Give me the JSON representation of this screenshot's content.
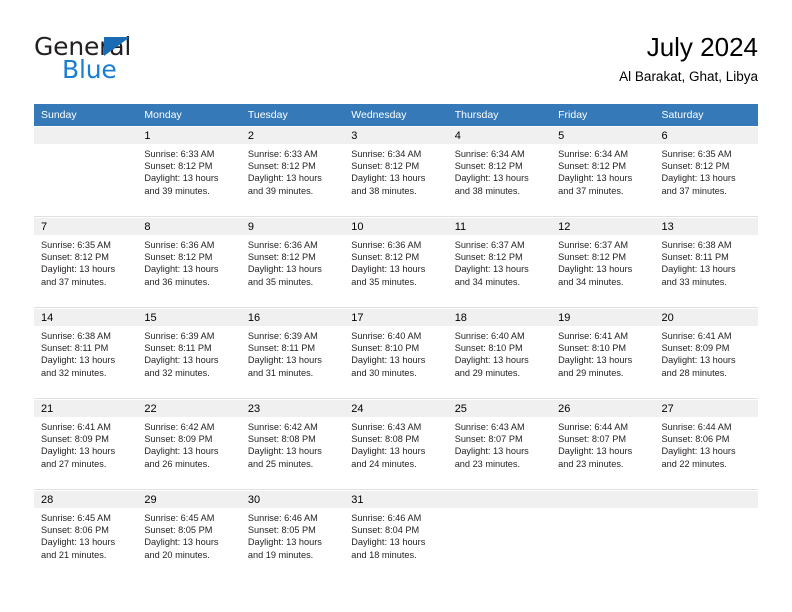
{
  "brand": {
    "name_top": "General",
    "name_bottom": "Blue",
    "triangle_color": "#1a6db5",
    "blue_text_color": "#1a7fd4"
  },
  "header": {
    "title": "July 2024",
    "subtitle": "Al Barakat, Ghat, Libya"
  },
  "theme": {
    "header_bg": "#3579b9",
    "header_text": "#ffffff",
    "daynum_bg": "#f0f0f0",
    "body_text": "#231f20"
  },
  "weekdays": [
    "Sunday",
    "Monday",
    "Tuesday",
    "Wednesday",
    "Thursday",
    "Friday",
    "Saturday"
  ],
  "weeks": [
    [
      {
        "day": "",
        "lines": []
      },
      {
        "day": "1",
        "lines": [
          "Sunrise: 6:33 AM",
          "Sunset: 8:12 PM",
          "Daylight: 13 hours",
          "and 39 minutes."
        ]
      },
      {
        "day": "2",
        "lines": [
          "Sunrise: 6:33 AM",
          "Sunset: 8:12 PM",
          "Daylight: 13 hours",
          "and 39 minutes."
        ]
      },
      {
        "day": "3",
        "lines": [
          "Sunrise: 6:34 AM",
          "Sunset: 8:12 PM",
          "Daylight: 13 hours",
          "and 38 minutes."
        ]
      },
      {
        "day": "4",
        "lines": [
          "Sunrise: 6:34 AM",
          "Sunset: 8:12 PM",
          "Daylight: 13 hours",
          "and 38 minutes."
        ]
      },
      {
        "day": "5",
        "lines": [
          "Sunrise: 6:34 AM",
          "Sunset: 8:12 PM",
          "Daylight: 13 hours",
          "and 37 minutes."
        ]
      },
      {
        "day": "6",
        "lines": [
          "Sunrise: 6:35 AM",
          "Sunset: 8:12 PM",
          "Daylight: 13 hours",
          "and 37 minutes."
        ]
      }
    ],
    [
      {
        "day": "7",
        "lines": [
          "Sunrise: 6:35 AM",
          "Sunset: 8:12 PM",
          "Daylight: 13 hours",
          "and 37 minutes."
        ]
      },
      {
        "day": "8",
        "lines": [
          "Sunrise: 6:36 AM",
          "Sunset: 8:12 PM",
          "Daylight: 13 hours",
          "and 36 minutes."
        ]
      },
      {
        "day": "9",
        "lines": [
          "Sunrise: 6:36 AM",
          "Sunset: 8:12 PM",
          "Daylight: 13 hours",
          "and 35 minutes."
        ]
      },
      {
        "day": "10",
        "lines": [
          "Sunrise: 6:36 AM",
          "Sunset: 8:12 PM",
          "Daylight: 13 hours",
          "and 35 minutes."
        ]
      },
      {
        "day": "11",
        "lines": [
          "Sunrise: 6:37 AM",
          "Sunset: 8:12 PM",
          "Daylight: 13 hours",
          "and 34 minutes."
        ]
      },
      {
        "day": "12",
        "lines": [
          "Sunrise: 6:37 AM",
          "Sunset: 8:12 PM",
          "Daylight: 13 hours",
          "and 34 minutes."
        ]
      },
      {
        "day": "13",
        "lines": [
          "Sunrise: 6:38 AM",
          "Sunset: 8:11 PM",
          "Daylight: 13 hours",
          "and 33 minutes."
        ]
      }
    ],
    [
      {
        "day": "14",
        "lines": [
          "Sunrise: 6:38 AM",
          "Sunset: 8:11 PM",
          "Daylight: 13 hours",
          "and 32 minutes."
        ]
      },
      {
        "day": "15",
        "lines": [
          "Sunrise: 6:39 AM",
          "Sunset: 8:11 PM",
          "Daylight: 13 hours",
          "and 32 minutes."
        ]
      },
      {
        "day": "16",
        "lines": [
          "Sunrise: 6:39 AM",
          "Sunset: 8:11 PM",
          "Daylight: 13 hours",
          "and 31 minutes."
        ]
      },
      {
        "day": "17",
        "lines": [
          "Sunrise: 6:40 AM",
          "Sunset: 8:10 PM",
          "Daylight: 13 hours",
          "and 30 minutes."
        ]
      },
      {
        "day": "18",
        "lines": [
          "Sunrise: 6:40 AM",
          "Sunset: 8:10 PM",
          "Daylight: 13 hours",
          "and 29 minutes."
        ]
      },
      {
        "day": "19",
        "lines": [
          "Sunrise: 6:41 AM",
          "Sunset: 8:10 PM",
          "Daylight: 13 hours",
          "and 29 minutes."
        ]
      },
      {
        "day": "20",
        "lines": [
          "Sunrise: 6:41 AM",
          "Sunset: 8:09 PM",
          "Daylight: 13 hours",
          "and 28 minutes."
        ]
      }
    ],
    [
      {
        "day": "21",
        "lines": [
          "Sunrise: 6:41 AM",
          "Sunset: 8:09 PM",
          "Daylight: 13 hours",
          "and 27 minutes."
        ]
      },
      {
        "day": "22",
        "lines": [
          "Sunrise: 6:42 AM",
          "Sunset: 8:09 PM",
          "Daylight: 13 hours",
          "and 26 minutes."
        ]
      },
      {
        "day": "23",
        "lines": [
          "Sunrise: 6:42 AM",
          "Sunset: 8:08 PM",
          "Daylight: 13 hours",
          "and 25 minutes."
        ]
      },
      {
        "day": "24",
        "lines": [
          "Sunrise: 6:43 AM",
          "Sunset: 8:08 PM",
          "Daylight: 13 hours",
          "and 24 minutes."
        ]
      },
      {
        "day": "25",
        "lines": [
          "Sunrise: 6:43 AM",
          "Sunset: 8:07 PM",
          "Daylight: 13 hours",
          "and 23 minutes."
        ]
      },
      {
        "day": "26",
        "lines": [
          "Sunrise: 6:44 AM",
          "Sunset: 8:07 PM",
          "Daylight: 13 hours",
          "and 23 minutes."
        ]
      },
      {
        "day": "27",
        "lines": [
          "Sunrise: 6:44 AM",
          "Sunset: 8:06 PM",
          "Daylight: 13 hours",
          "and 22 minutes."
        ]
      }
    ],
    [
      {
        "day": "28",
        "lines": [
          "Sunrise: 6:45 AM",
          "Sunset: 8:06 PM",
          "Daylight: 13 hours",
          "and 21 minutes."
        ]
      },
      {
        "day": "29",
        "lines": [
          "Sunrise: 6:45 AM",
          "Sunset: 8:05 PM",
          "Daylight: 13 hours",
          "and 20 minutes."
        ]
      },
      {
        "day": "30",
        "lines": [
          "Sunrise: 6:46 AM",
          "Sunset: 8:05 PM",
          "Daylight: 13 hours",
          "and 19 minutes."
        ]
      },
      {
        "day": "31",
        "lines": [
          "Sunrise: 6:46 AM",
          "Sunset: 8:04 PM",
          "Daylight: 13 hours",
          "and 18 minutes."
        ]
      },
      {
        "day": "",
        "lines": []
      },
      {
        "day": "",
        "lines": []
      },
      {
        "day": "",
        "lines": []
      }
    ]
  ]
}
